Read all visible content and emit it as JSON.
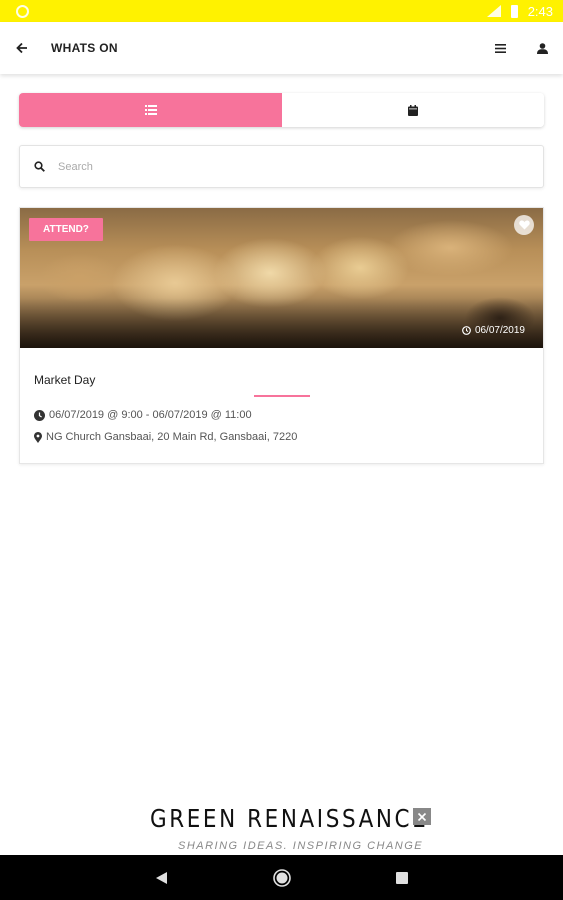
{
  "status_bar": {
    "time": "2:43"
  },
  "app_bar": {
    "title": "WHATS ON"
  },
  "search": {
    "placeholder": "Search",
    "value": ""
  },
  "colors": {
    "accent": "#f7739b",
    "status_bar": "#fff200"
  },
  "events": [
    {
      "badge": "ATTEND?",
      "image_date": "06/07/2019",
      "title": "Market Day",
      "time_range": "06/07/2019 @ 9:00 - 06/07/2019 @ 11:00",
      "location": "NG Church Gansbaai, 20 Main Rd, Gansbaai, 7220"
    }
  ],
  "footer": {
    "logo_name": "GREEN RENAISSANCE",
    "logo_tagline": "SHARING IDEAS. INSPIRING CHANGE"
  },
  "icons": {
    "back": "arrow-left-icon",
    "menu": "list-icon",
    "profile": "person-icon",
    "list_view": "list-icon",
    "calendar_view": "calendar-icon",
    "search": "search-icon",
    "favorite": "heart-icon",
    "clock": "clock-icon",
    "location": "map-pin-icon"
  }
}
